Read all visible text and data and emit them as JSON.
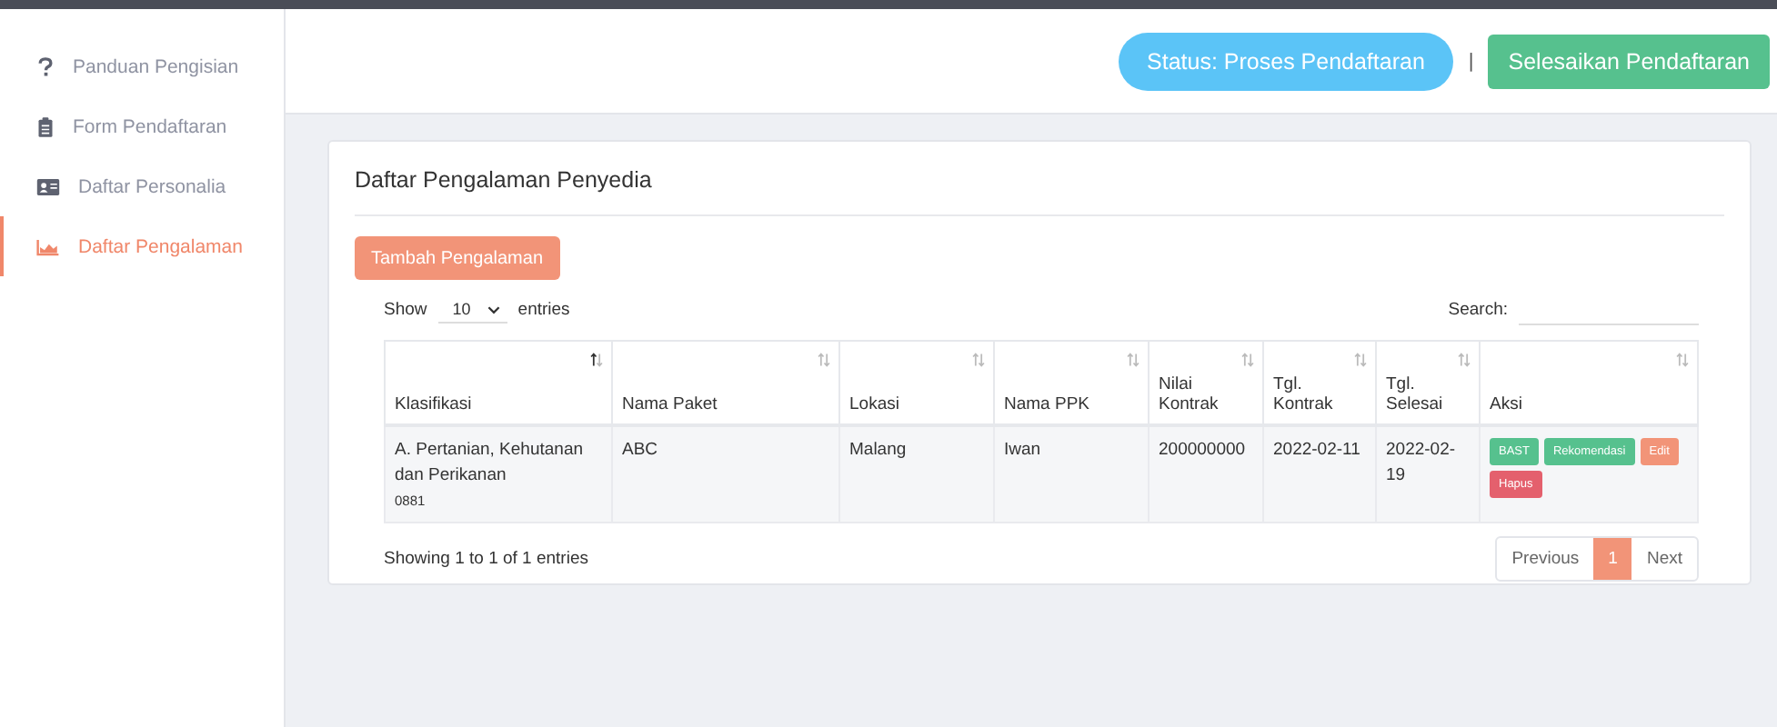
{
  "sidebar": {
    "items": [
      {
        "label": "Panduan Pengisian",
        "selected": false
      },
      {
        "label": "Form Pendaftaran",
        "selected": false
      },
      {
        "label": "Daftar Personalia",
        "selected": false
      },
      {
        "label": "Daftar Pengalaman",
        "selected": true
      }
    ]
  },
  "header": {
    "status": "Status: Proses Pendaftaran",
    "separator": "|",
    "finish_button": "Selesaikan Pendaftaran"
  },
  "card": {
    "title": "Daftar Pengalaman Penyedia",
    "add_button": "Tambah Pengalaman",
    "length": {
      "before": "Show",
      "value": "10",
      "after": "entries"
    },
    "search": {
      "label": "Search:"
    },
    "table": {
      "columns": [
        {
          "label": "Klasifikasi",
          "sorted": true
        },
        {
          "label": "Nama Paket",
          "sorted": false
        },
        {
          "label": "Lokasi",
          "sorted": false
        },
        {
          "label": "Nama PPK",
          "sorted": false
        },
        {
          "label": "Nilai Kontrak",
          "sorted": false
        },
        {
          "label": "Tgl. Kontrak",
          "sorted": false
        },
        {
          "label": "Tgl. Selesai",
          "sorted": false
        },
        {
          "label": "Aksi",
          "sorted": false
        }
      ],
      "rows": [
        {
          "cells": [
            "A. Pertanian, Kehutanan dan Perikanan",
            "ABC",
            "Malang",
            "Iwan",
            "200000000",
            "2022-02-11",
            "2022-02-19"
          ],
          "kode": "0881",
          "actions": [
            {
              "label": "BAST",
              "kind": "success"
            },
            {
              "label": "Rekomendasi",
              "kind": "success"
            },
            {
              "label": "Edit",
              "kind": "warning"
            },
            {
              "label": "Hapus",
              "kind": "danger"
            }
          ]
        }
      ]
    },
    "info": "Showing 1 to 1 of 1 entries",
    "pagination": [
      {
        "label": "Previous",
        "selected": false
      },
      {
        "label": "1",
        "selected": true
      },
      {
        "label": "Next",
        "selected": false
      }
    ]
  }
}
